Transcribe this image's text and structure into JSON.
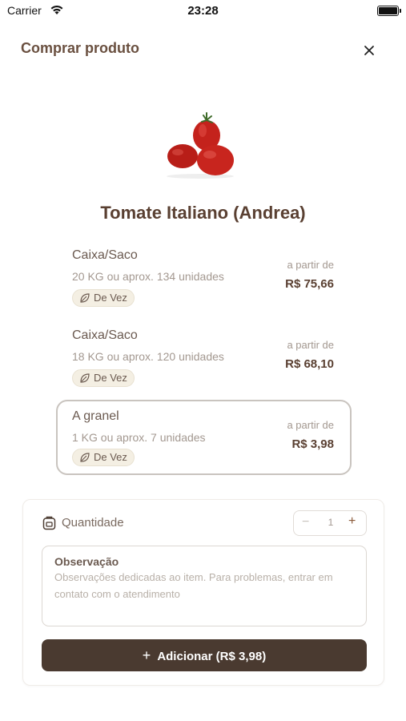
{
  "status_bar": {
    "carrier": "Carrier",
    "time": "23:28"
  },
  "header": {
    "title": "Comprar produto",
    "close_icon": "close-icon"
  },
  "product": {
    "name": "Tomate Italiano (Andrea)"
  },
  "options": [
    {
      "type": "Caixa/Saco",
      "description": "20 KG ou aprox. 134 unidades",
      "tag": "De Vez",
      "from_label": "a partir de",
      "price": "R$ 75,66",
      "selected": false
    },
    {
      "type": "Caixa/Saco",
      "description": "18 KG ou aprox. 120 unidades",
      "tag": "De Vez",
      "from_label": "a partir de",
      "price": "R$ 68,10",
      "selected": false
    },
    {
      "type": "A granel",
      "description": "1 KG ou aprox. 7 unidades",
      "tag": "De Vez",
      "from_label": "a partir de",
      "price": "R$ 3,98",
      "selected": true
    }
  ],
  "quantity": {
    "label": "Quantidade",
    "minus": "−",
    "value": "1",
    "plus": "+"
  },
  "observation": {
    "title": "Observação",
    "placeholder": "Observações dedicadas ao item. Para problemas, entrar em contato com o atendimento"
  },
  "add_button": {
    "plus": "+",
    "label": "Adicionar (R$ 3,98)"
  },
  "colors": {
    "brand_dark": "#4a3a30",
    "tag_bg": "#f4efe3",
    "selected_border": "#c9c4bf"
  }
}
